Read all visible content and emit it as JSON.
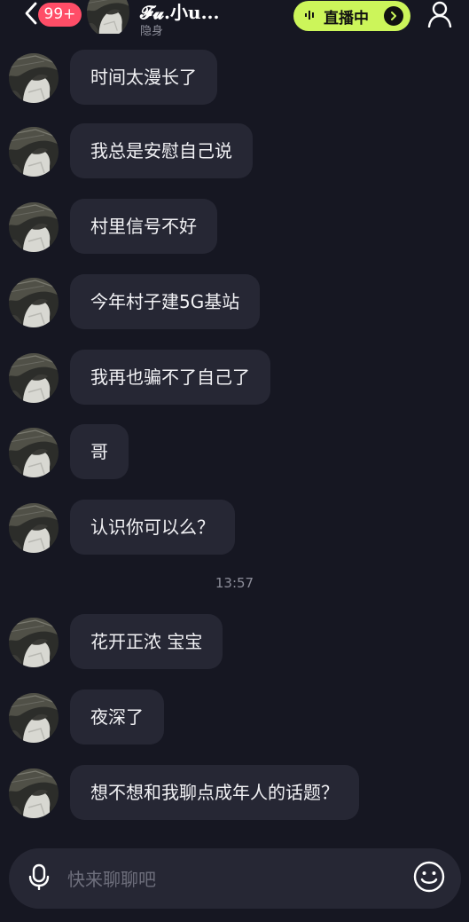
{
  "header": {
    "unread_badge": "99+",
    "user_name": "𝓕𝓾.小u...",
    "user_status": "隐身",
    "live_label": "直播中"
  },
  "messages": [
    {
      "text": "时间太漫长了"
    },
    {
      "text": "我总是安慰自己说"
    },
    {
      "text": "村里信号不好"
    },
    {
      "text": "今年村子建5G基站"
    },
    {
      "text": "我再也骗不了自己了"
    },
    {
      "text": "哥"
    },
    {
      "text": "认识你可以么？"
    },
    {
      "text": "花开正浓 宝宝"
    },
    {
      "text": "夜深了"
    },
    {
      "text": "想不想和我聊点成年人的话题？"
    }
  ],
  "timestamp": "13:57",
  "input": {
    "placeholder": "快来聊聊吧",
    "value": ""
  },
  "icons": {
    "back": "chevron-left-icon",
    "live_wave": "sound-wave-icon",
    "live_arrow": "arrow-right-icon",
    "profile": "person-icon",
    "voice": "microphone-icon",
    "emoji": "smiley-icon"
  },
  "colors": {
    "background": "#161722",
    "bubble": "#262734",
    "badge": "#ff4d67",
    "live_accent": "#ccf55a"
  }
}
